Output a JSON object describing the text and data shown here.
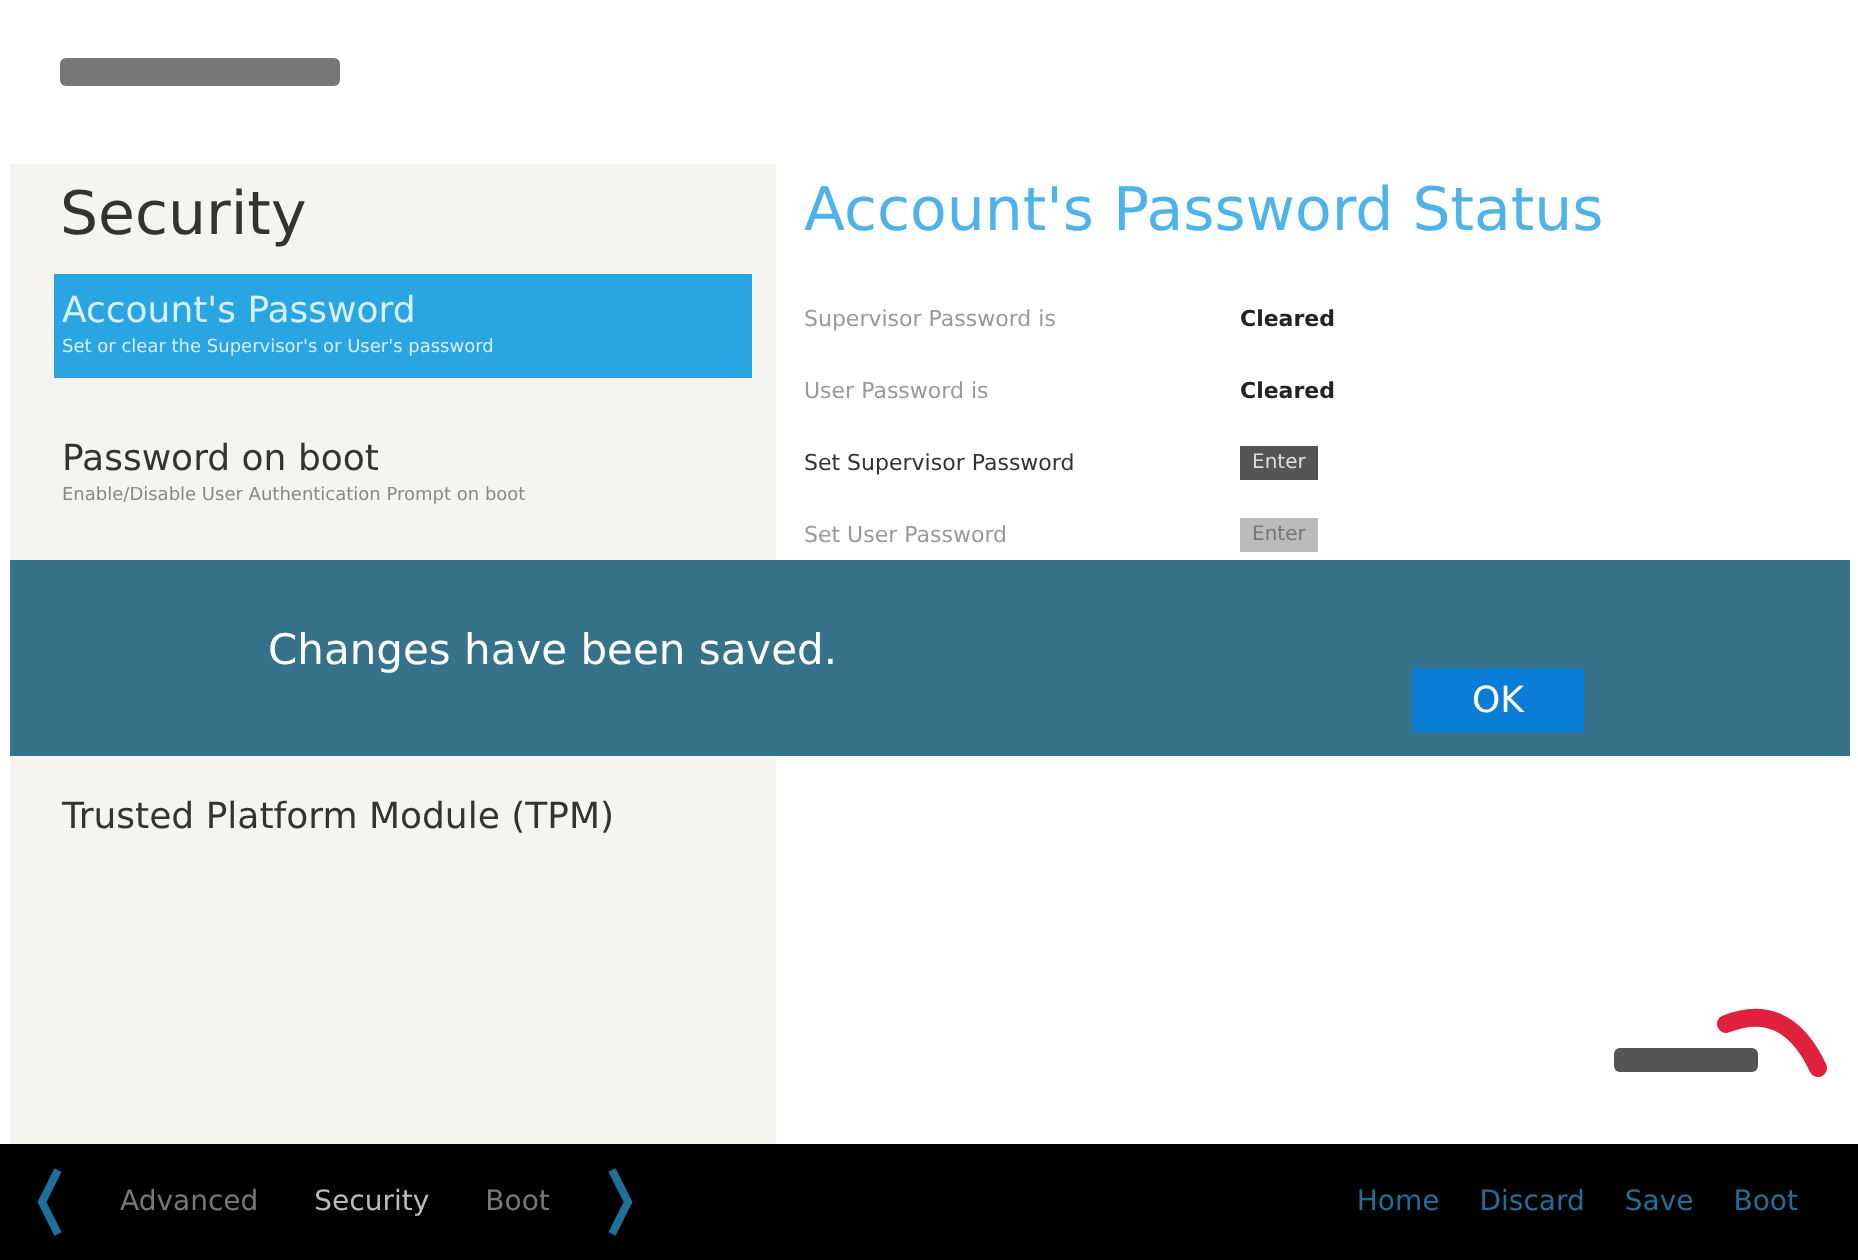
{
  "sidebar": {
    "title": "Security",
    "items": [
      {
        "label": "Account's Password",
        "description": "Set or clear the Supervisor's or User's password",
        "selected": true
      },
      {
        "label": "Password on boot",
        "description": "Enable/Disable User Authentication Prompt on boot",
        "selected": false
      },
      {
        "label": "Trusted Platform Module (TPM)",
        "selected": false
      }
    ]
  },
  "panel": {
    "title": "Account's Password Status",
    "rows": [
      {
        "kind": "status",
        "label": "Supervisor Password is",
        "value": "Cleared"
      },
      {
        "kind": "status",
        "label": "User Password is",
        "value": "Cleared"
      },
      {
        "kind": "action",
        "label": "Set Supervisor Password",
        "button": "Enter",
        "disabled": false
      },
      {
        "kind": "action",
        "label": "Set User Password",
        "button": "Enter",
        "disabled": true
      }
    ]
  },
  "dialog": {
    "message": "Changes have been saved.",
    "button": "OK"
  },
  "footer": {
    "tabs": [
      {
        "label": "Advanced",
        "selected": false
      },
      {
        "label": "Security",
        "selected": true
      },
      {
        "label": "Boot",
        "selected": false
      }
    ],
    "actions": [
      "Home",
      "Discard",
      "Save",
      "Boot"
    ]
  }
}
